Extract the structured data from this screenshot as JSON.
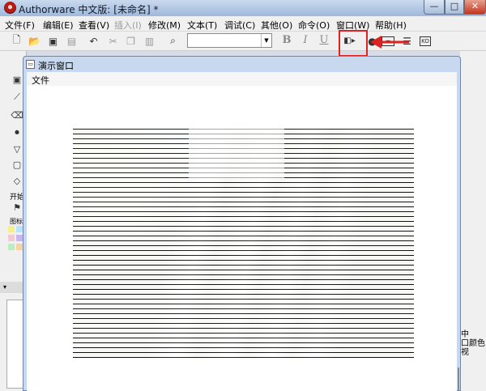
{
  "app": {
    "title": "Authorware 中文版: [未命名] *",
    "btn_min": "—",
    "btn_max": "□",
    "btn_close": "✕"
  },
  "menu": {
    "items": [
      "文件(F)",
      "编辑(E)",
      "查看(V)",
      "插入(I)",
      "修改(M)",
      "文本(T)",
      "调试(C)",
      "其他(O)",
      "命令(O)",
      "窗口(W)",
      "帮助(H)"
    ]
  },
  "toolbar": {
    "bold": "B",
    "italic": "I",
    "underline": "U",
    "font_value": "",
    "combo_arrow": "▼",
    "icons": [
      "new-file-icon",
      "open-file-icon",
      "save-all-icon",
      "import-icon",
      "undo-icon",
      "cut-icon",
      "copy-icon",
      "paste-icon",
      "find-icon",
      "control-panel-icon",
      "function-icon",
      "variable-icon",
      "knowledge-object-icon"
    ]
  },
  "left_panel": {
    "label": "开始",
    "label2": "图标"
  },
  "lower_panel": {
    "bar": "▾"
  },
  "right_panel": {
    "text": "中\n口颜色\n视"
  },
  "demo_window": {
    "title": "演示窗口",
    "menu_file": "文件"
  },
  "colors": {
    "accent": "#d22",
    "titlebar": "#9fb9dc",
    "close": "#c2361e"
  }
}
